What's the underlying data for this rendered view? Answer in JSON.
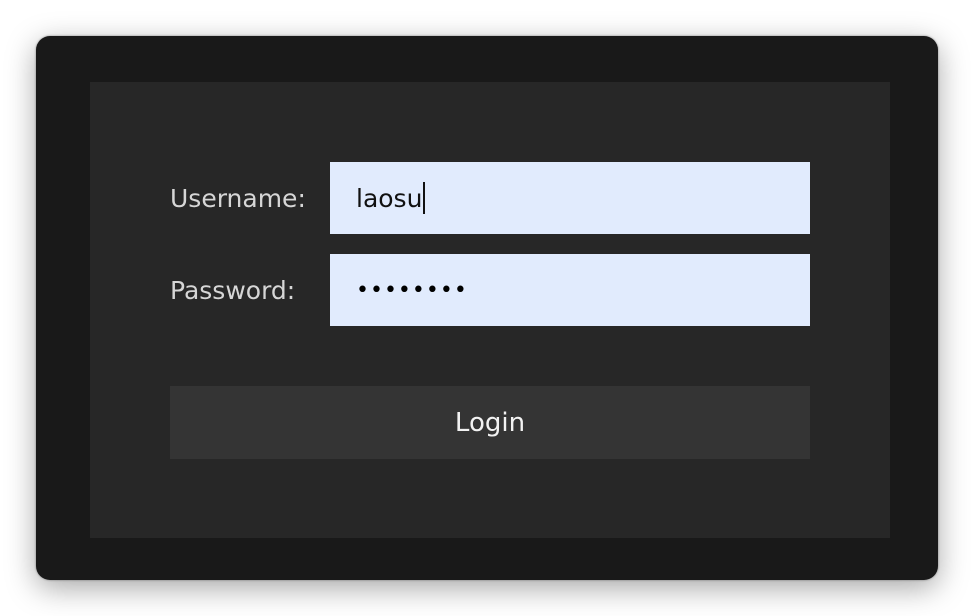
{
  "form": {
    "username_label": "Username:",
    "password_label": "Password:",
    "username_value": "laosu",
    "password_mask": "••••••••",
    "login_label": "Login"
  },
  "colors": {
    "window_bg": "#191919",
    "panel_bg": "#272727",
    "field_bg": "#e1ebfd",
    "button_bg": "#343434",
    "label_text": "#d6d6d6",
    "button_text": "#f2f2f2"
  }
}
